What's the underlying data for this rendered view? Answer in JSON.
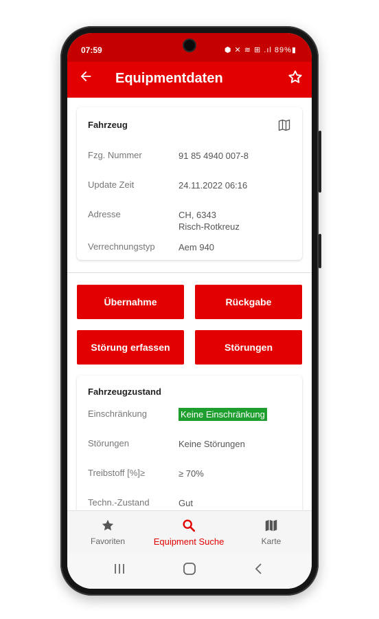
{
  "status_bar": {
    "time": "07:59",
    "icons_text": "⬢ ✕ ≋ ⊞ .ıl 89%▮"
  },
  "app_bar": {
    "back_icon": "arrow-left",
    "title": "Equipmentdaten",
    "favorite_icon": "star-outline"
  },
  "vehicle_card": {
    "title": "Fahrzeug",
    "map_icon": "map",
    "rows": [
      {
        "label": "Fzg. Nummer",
        "value": "91 85 4940 007-8"
      },
      {
        "label": "Update Zeit",
        "value": "24.11.2022 06:16"
      },
      {
        "label": "Adresse",
        "value_line1": "CH, 6343",
        "value_line2": "Risch-Rotkreuz"
      },
      {
        "label": "Verrechnungstyp",
        "value": "Aem 940"
      }
    ]
  },
  "actions": {
    "takeover": "Übernahme",
    "return": "Rückgabe",
    "report_fault": "Störung erfassen",
    "faults": "Störungen"
  },
  "condition_card": {
    "title": "Fahrzeugzustand",
    "rows": [
      {
        "label": "Einschränkung",
        "value": "Keine Einschränkung",
        "value_color": "#1e9e2e"
      },
      {
        "label": "Störungen",
        "value": "Keine Störungen"
      },
      {
        "label": "Treibstoff [%]≥",
        "value": "≥ 70%"
      },
      {
        "label": "Techn.-Zustand",
        "value": "Gut"
      }
    ]
  },
  "bottom_nav": {
    "items": [
      {
        "label": "Favoriten",
        "icon": "star"
      },
      {
        "label": "Equipment Suche",
        "icon": "search",
        "active": true
      },
      {
        "label": "Karte",
        "icon": "map"
      }
    ]
  },
  "colors": {
    "primary_red": "#e30000",
    "status_red": "#c40000",
    "ok_green": "#1e9e2e"
  }
}
